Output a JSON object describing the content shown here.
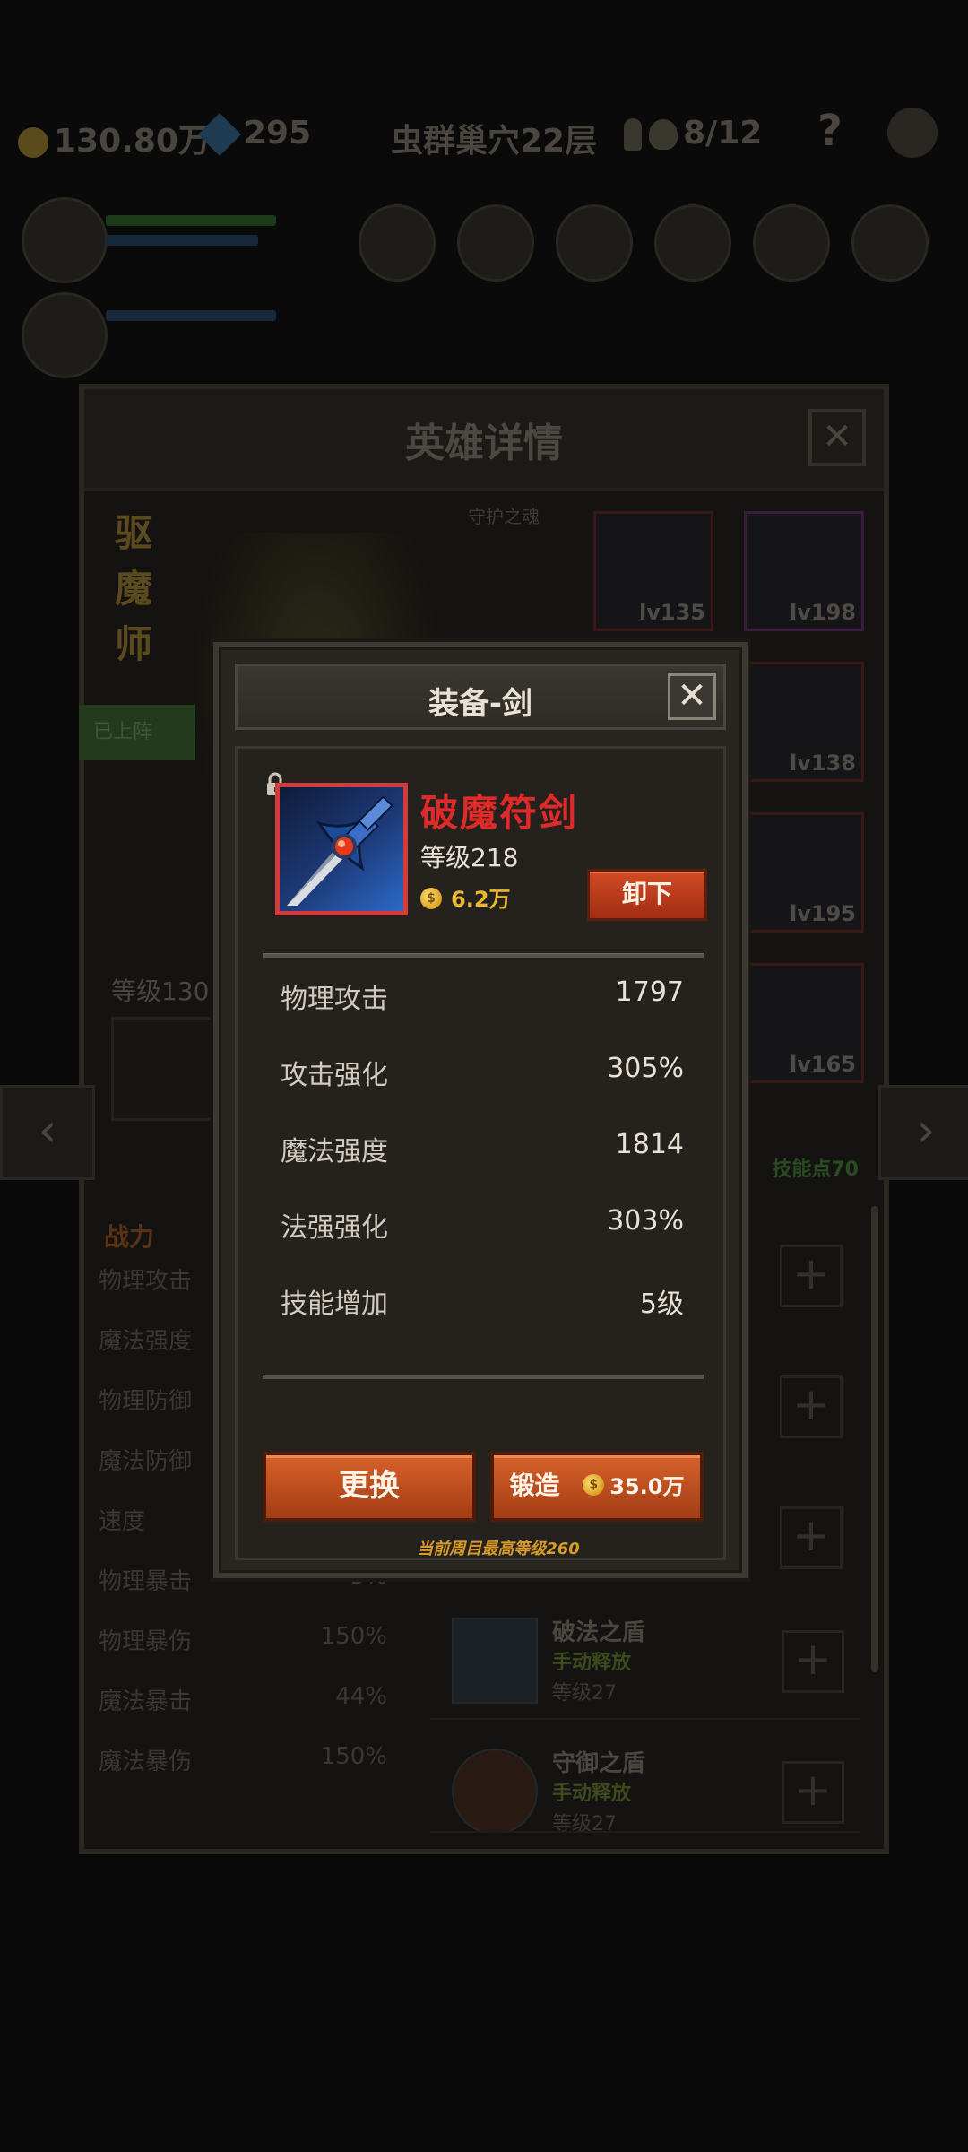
{
  "topbar": {
    "gold": "130.80万",
    "gems": "295",
    "dungeon": "虫群巢穴22层",
    "skull_count": "8/12",
    "help": "?"
  },
  "hero_panel": {
    "title": "英雄详情",
    "close": "✕",
    "hero_name": "驱魔师",
    "hero_title": "守护之魂",
    "deployed": "已上阵",
    "level_label": "等级130",
    "skill_points": "技能点70",
    "equip_slots": [
      {
        "lv": "lv135"
      },
      {
        "lv": "lv198"
      },
      {
        "lv": "lv138"
      },
      {
        "lv": "lv195"
      },
      {
        "lv": "lv165"
      }
    ],
    "stats_header": "战力",
    "stats": [
      {
        "name": "物理攻击",
        "value": ""
      },
      {
        "name": "魔法强度",
        "value": ""
      },
      {
        "name": "物理防御",
        "value": ""
      },
      {
        "name": "魔法防御",
        "value": ""
      },
      {
        "name": "速度",
        "value": ""
      },
      {
        "name": "物理暴击",
        "value": "5%"
      },
      {
        "name": "物理暴伤",
        "value": "150%"
      },
      {
        "name": "魔法暴击",
        "value": "44%"
      },
      {
        "name": "魔法暴伤",
        "value": "150%"
      }
    ],
    "skills": [
      {
        "name": "破法之盾",
        "type": "手动释放",
        "level": "等级27"
      },
      {
        "name": "守御之盾",
        "type": "手动释放",
        "level": "等级27"
      }
    ],
    "plus": "+",
    "nav_prev": "‹",
    "nav_next": "›"
  },
  "modal": {
    "title": "装备-剑",
    "close": "✕",
    "item_name": "破魔符剑",
    "item_level": "等级218",
    "item_price": "6.2万",
    "coin_glyph": "$",
    "unequip_label": "卸下",
    "attributes": [
      {
        "name": "物理攻击",
        "value": "1797"
      },
      {
        "name": "攻击强化",
        "value": "305%"
      },
      {
        "name": "魔法强度",
        "value": "1814"
      },
      {
        "name": "法强强化",
        "value": "303%"
      },
      {
        "name": "技能增加",
        "value": "5级"
      }
    ],
    "replace_label": "更换",
    "forge_label": "锻造",
    "forge_cost": "35.0万",
    "max_level_note": "当前周目最高等级260"
  },
  "colors": {
    "item_name": "#e02a2a",
    "button_orange": "#d24a24",
    "gold_text": "#e9b730",
    "modal_bg": "#292622"
  }
}
